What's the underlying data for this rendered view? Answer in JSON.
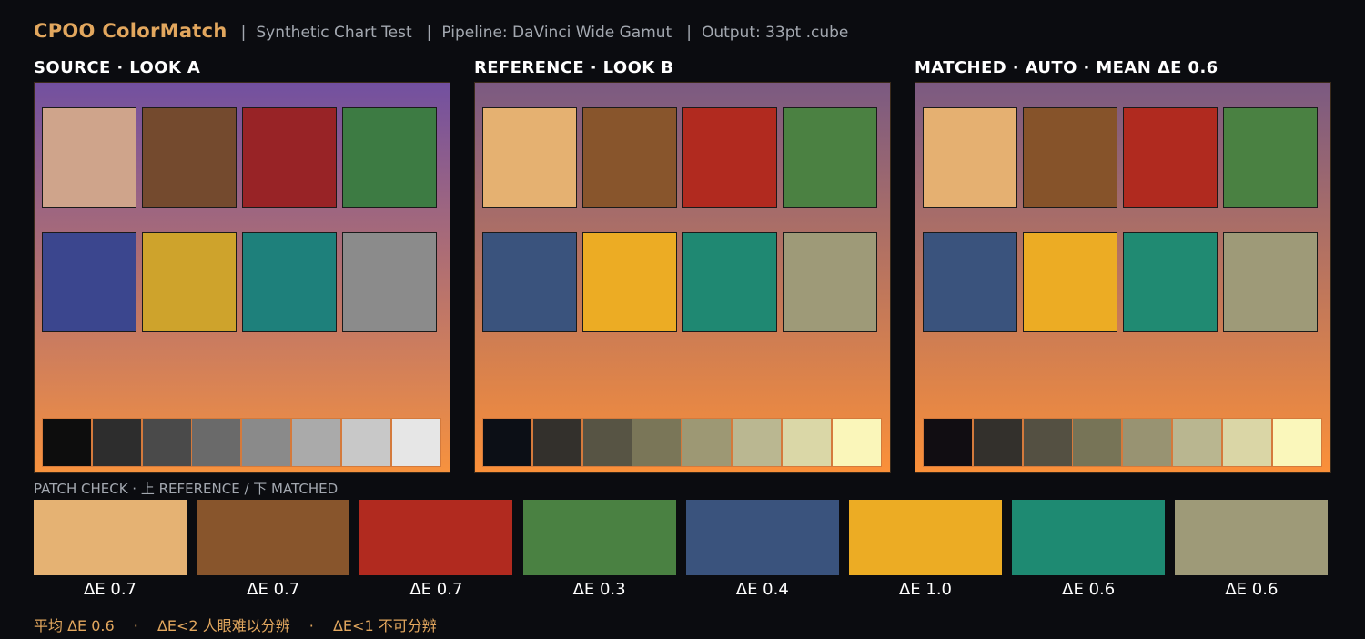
{
  "header": {
    "brand": "CPOO ColorMatch",
    "separator": "|",
    "items": [
      "Synthetic Chart Test",
      "Pipeline: DaVinci Wide Gamut",
      "Output: 33pt .cube"
    ]
  },
  "panels": [
    {
      "title": "SOURCE · LOOK A",
      "gradient_top": "#7250a0",
      "gradient_bottom": "#f7923e",
      "patches": [
        "#cfa48b",
        "#744a2e",
        "#982326",
        "#3d7b43",
        "#3b468e",
        "#cea32c",
        "#1e807b",
        "#8b8b8b"
      ],
      "grays": [
        "#0d0d0d",
        "#2d2d2d",
        "#4a4a4a",
        "#6a6a6a",
        "#8a8a8a",
        "#aaaaaa",
        "#c8c8c8",
        "#e6e6e6"
      ]
    },
    {
      "title": "REFERENCE · LOOK B",
      "gradient_top": "#7b5a82",
      "gradient_bottom": "#fb9039",
      "patches": [
        "#e5b171",
        "#88552c",
        "#b12a1f",
        "#4b8142",
        "#3a537d",
        "#ecac24",
        "#1f8872",
        "#9e9a78"
      ],
      "grays": [
        "#0c0f16",
        "#33302c",
        "#575444",
        "#7a7658",
        "#9d9874",
        "#bab791",
        "#dad7a7",
        "#faf6ba"
      ]
    },
    {
      "title": "MATCHED · AUTO · MEAN ΔE 0.6",
      "gradient_top": "#7b5a82",
      "gradient_bottom": "#fb9039",
      "patches": [
        "#e5b071",
        "#86532a",
        "#b02a1f",
        "#4a8142",
        "#3a537d",
        "#ecac24",
        "#208a72",
        "#9e9a78"
      ],
      "grays": [
        "#110d12",
        "#33302c",
        "#545042",
        "#777457",
        "#989372",
        "#b9b690",
        "#dad6a6",
        "#faf7bb"
      ]
    }
  ],
  "patch_check": {
    "label": "PATCH CHECK  ·  上 REFERENCE / 下 MATCHED",
    "patches": [
      {
        "color": "#e5b273",
        "de": "ΔE 0.7"
      },
      {
        "color": "#88552c",
        "de": "ΔE 0.7"
      },
      {
        "color": "#b12a1f",
        "de": "ΔE 0.7"
      },
      {
        "color": "#4a8142",
        "de": "ΔE 0.3"
      },
      {
        "color": "#3a537d",
        "de": "ΔE 0.4"
      },
      {
        "color": "#ecac24",
        "de": "ΔE 1.0"
      },
      {
        "color": "#1e8a72",
        "de": "ΔE 0.6"
      },
      {
        "color": "#9e9a78",
        "de": "ΔE 0.6"
      }
    ]
  },
  "footer": {
    "mean": "平均 ΔE 0.6",
    "dot": "·",
    "note1": "ΔE<2 人眼难以分辨",
    "note2": "ΔE<1 不可分辨"
  },
  "colors": {
    "accent": "#e2a75e",
    "muted": "#a3a8b0",
    "background": "#0b0c10"
  }
}
